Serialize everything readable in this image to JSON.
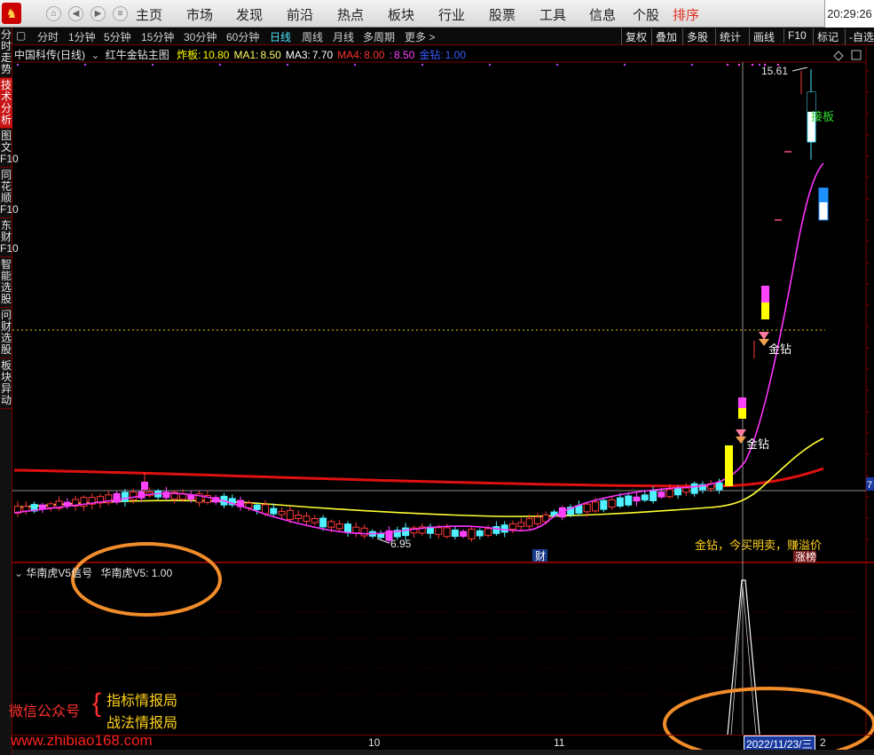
{
  "topbar": {
    "menu": [
      "主页",
      "市场",
      "发现",
      "前沿",
      "热点",
      "板块",
      "行业",
      "股票",
      "工具",
      "信息",
      "个股",
      "排序"
    ],
    "active_menu": "排序",
    "clock": "20:29:26"
  },
  "periods": [
    "分时",
    "1分钟",
    "5分钟",
    "15分钟",
    "30分钟",
    "60分钟",
    "日线",
    "周线",
    "月线",
    "多周期",
    "更多 >"
  ],
  "selected_period": "日线",
  "right_tools": [
    "复权",
    "叠加",
    "多股",
    "统计",
    "画线",
    "F10",
    "标记",
    "-自选"
  ],
  "left_tabs": [
    "分时走势",
    "技术分析",
    "图文F10",
    "同花顺F10",
    "东财F10",
    "智能选股",
    "问财选股",
    "板块异动"
  ],
  "selected_left_tab": "技术分析",
  "info": {
    "stock": "中国科传(日线)",
    "indicator": "红牛金钻主图",
    "fields": [
      {
        "label": "炸板:",
        "value": "10.80",
        "color": "#ffff00"
      },
      {
        "label": "MA1:",
        "value": "8.50",
        "color": "#ffff66"
      },
      {
        "label": "MA3:",
        "value": "7.70",
        "color": "#ffffff"
      },
      {
        "label": "MA4:",
        "value": "8.00",
        "color": "#ff3030"
      },
      {
        "label": ":",
        "value": "8.50",
        "color": "#ff44ff"
      },
      {
        "label": "金钻:",
        "value": "1.00",
        "color": "#3a5bff"
      }
    ]
  },
  "annotations": {
    "high_price": "15.61",
    "low_price": "6.95",
    "limit_up": "接板",
    "gold1": "金钻",
    "gold2": "金钻",
    "cai": "财",
    "note": "金钻，今买明卖，赚溢价",
    "rank": "涨榜",
    "price_axis": "7"
  },
  "sub_indicator": {
    "title": "华南虎V5信号",
    "value_label": "华南虎V5:",
    "value": "1.00"
  },
  "watermark": {
    "wechat": "微信公众号",
    "brace": "{",
    "line1": "指标情报局",
    "line2": "战法情报局",
    "url": "www.zhibiao168.com"
  },
  "date_axis": {
    "labels": [
      "10",
      "11"
    ],
    "cursor_date": "2022/11/23/三",
    "end_label": "2"
  },
  "colors": {
    "ma_yellow": "#ffff33",
    "ma_magenta": "#ff33ff",
    "ma_red": "#e01010",
    "up": "#ff3a3a",
    "down": "#4ff0ff",
    "orange_circle": "#f08c2a"
  }
}
